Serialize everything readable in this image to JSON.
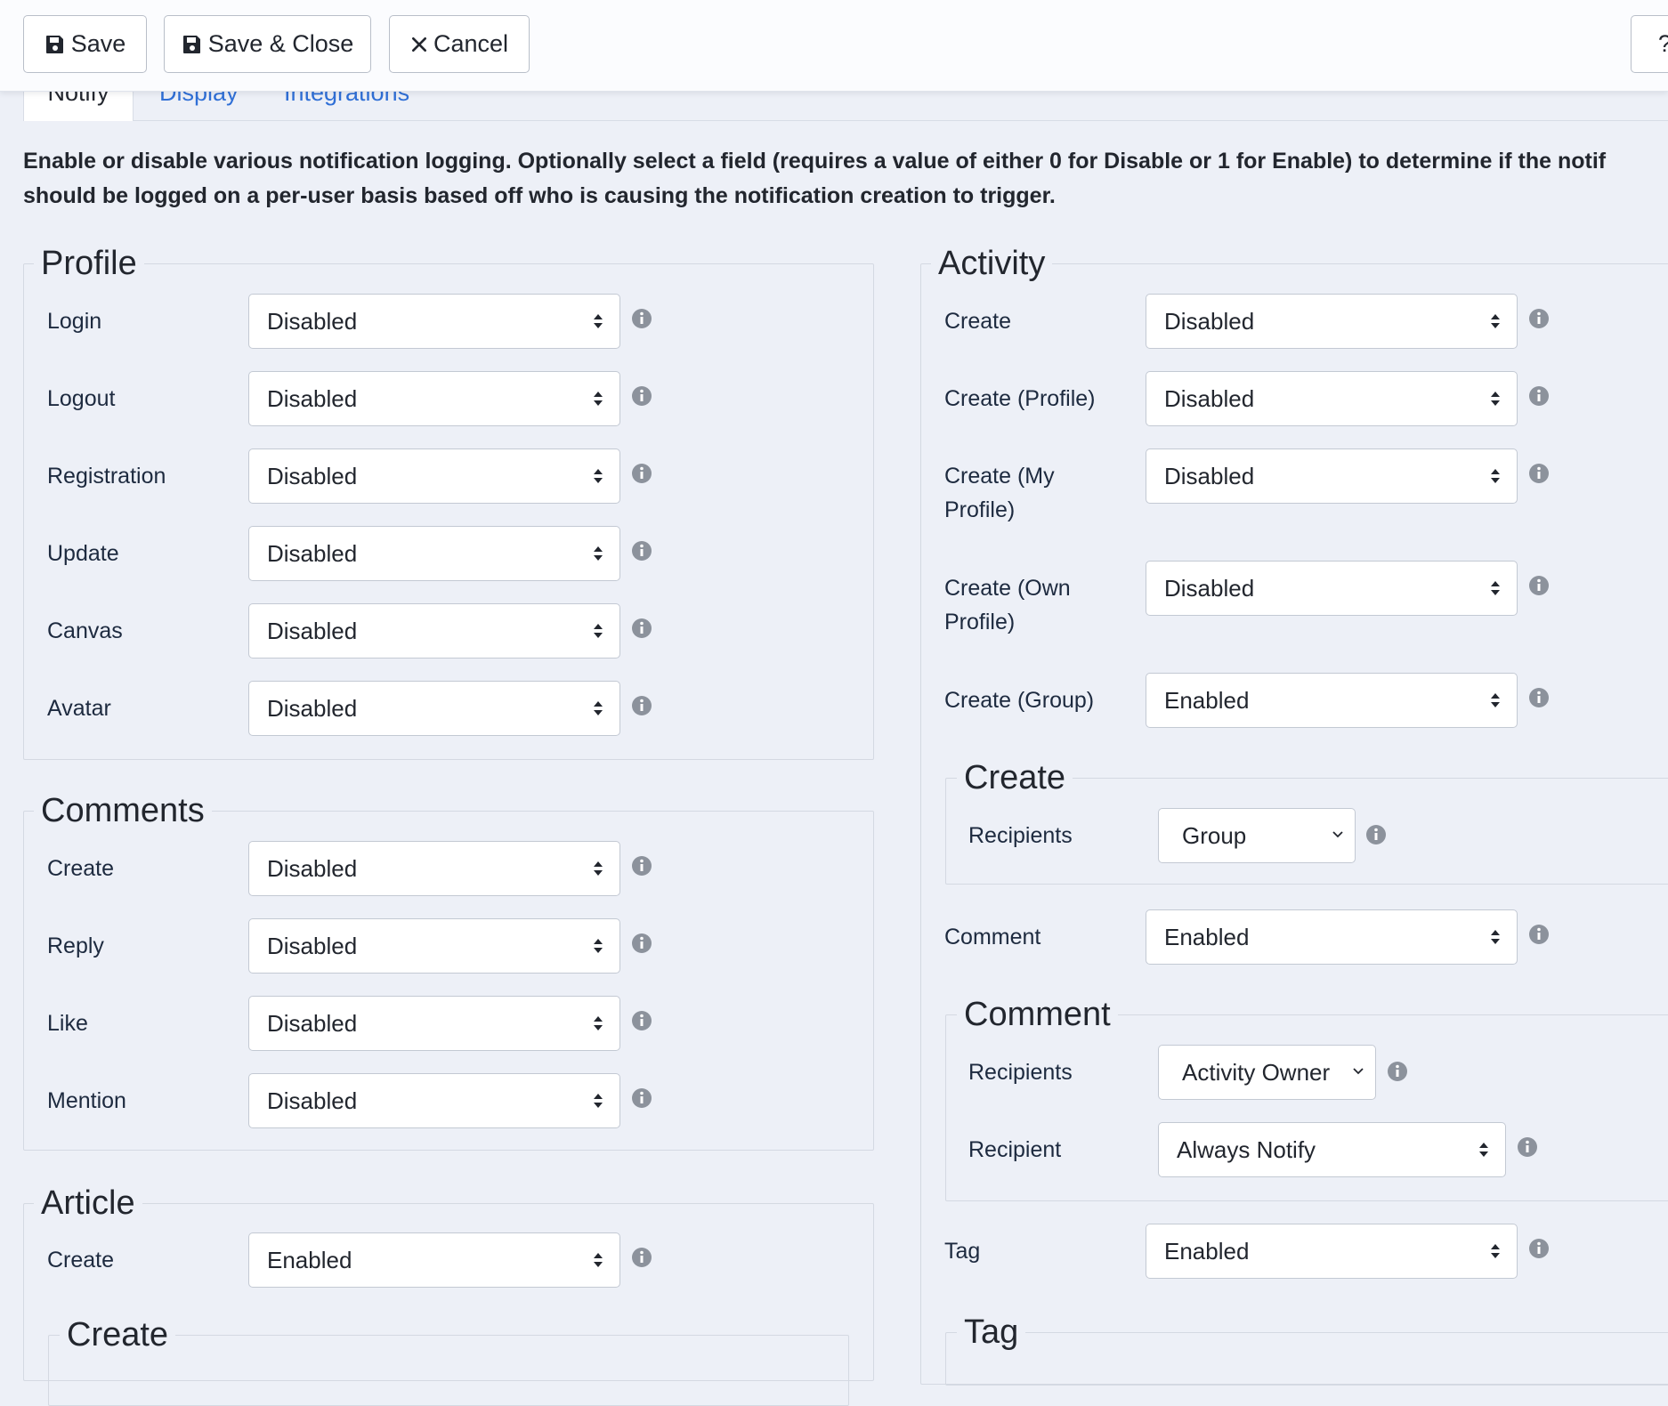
{
  "toolbar": {
    "save": "Save",
    "save_close": "Save & Close",
    "cancel": "Cancel",
    "help": "?"
  },
  "tabs": [
    "Notify",
    "Display",
    "Integrations"
  ],
  "description": {
    "line1": "Enable or disable various notification logging. Optionally select a field (requires a value of either 0 for Disable or 1 for Enable) to determine if the notif",
    "line2": "should be logged on a per-user basis based off who is causing the notification creation to trigger."
  },
  "profile": {
    "legend": "Profile",
    "rows": [
      {
        "label": "Login",
        "value": "Disabled"
      },
      {
        "label": "Logout",
        "value": "Disabled"
      },
      {
        "label": "Registration",
        "value": "Disabled"
      },
      {
        "label": "Update",
        "value": "Disabled"
      },
      {
        "label": "Canvas",
        "value": "Disabled"
      },
      {
        "label": "Avatar",
        "value": "Disabled"
      }
    ]
  },
  "comments": {
    "legend": "Comments",
    "rows": [
      {
        "label": "Create",
        "value": "Disabled"
      },
      {
        "label": "Reply",
        "value": "Disabled"
      },
      {
        "label": "Like",
        "value": "Disabled"
      },
      {
        "label": "Mention",
        "value": "Disabled"
      }
    ]
  },
  "article": {
    "legend": "Article",
    "rows": [
      {
        "label": "Create",
        "value": "Enabled"
      }
    ],
    "sub_legend": "Create"
  },
  "activity": {
    "legend": "Activity",
    "rows": [
      {
        "label": "Create",
        "value": "Disabled"
      },
      {
        "label": "Create (Profile)",
        "value": "Disabled"
      },
      {
        "label_line1": "Create (My",
        "label_line2": "Profile)",
        "value": "Disabled"
      },
      {
        "label_line1": "Create (Own",
        "label_line2": "Profile)",
        "value": "Disabled"
      },
      {
        "label": "Create (Group)",
        "value": "Enabled"
      }
    ],
    "create_group": {
      "legend": "Create",
      "recipients_label": "Recipients",
      "recipients_value": "Group"
    },
    "comment_row": {
      "label": "Comment",
      "value": "Enabled"
    },
    "comment_group": {
      "legend": "Comment",
      "recipients_label": "Recipients",
      "recipients_value": "Activity Owner",
      "recipient_label": "Recipient",
      "recipient_value": "Always Notify"
    },
    "tag_row": {
      "label": "Tag",
      "value": "Enabled"
    },
    "tag_group": {
      "legend": "Tag"
    }
  },
  "colors": {
    "background": "#edf0f7",
    "link": "#2f6fd6",
    "info_icon": "#8c929c"
  }
}
